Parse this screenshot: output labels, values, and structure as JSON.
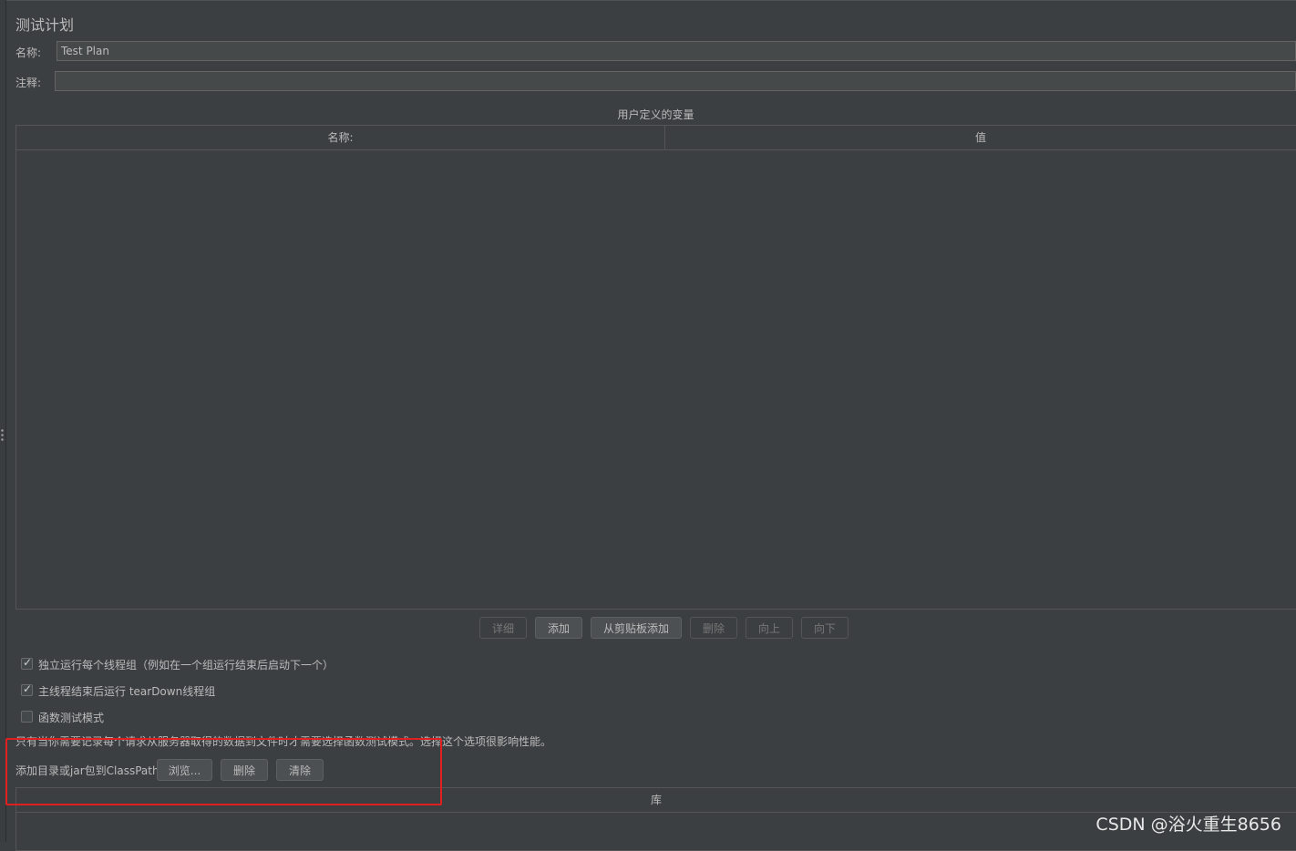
{
  "panel": {
    "title": "测试计划"
  },
  "form": {
    "name_label": "名称:",
    "name_value": "Test Plan",
    "comment_label": "注释:",
    "comment_value": ""
  },
  "variables_table": {
    "caption": "用户定义的变量",
    "columns": [
      "名称:",
      "值"
    ]
  },
  "table_buttons": {
    "detail": "详细",
    "add": "添加",
    "add_from_clipboard": "从剪贴板添加",
    "delete": "删除",
    "up": "向上",
    "down": "向下"
  },
  "options": {
    "serialize_thread_groups": {
      "label": "独立运行每个线程组（例如在一个组运行结束后启动下一个）",
      "checked": true
    },
    "teardown_after_shutdown": {
      "label": "主线程结束后运行 tearDown线程组",
      "checked": true
    },
    "functional_mode": {
      "label": "函数测试模式",
      "checked": false
    }
  },
  "functional_mode_hint": "只有当你需要记录每个请求从服务器取得的数据到文件时才需要选择函数测试模式。选择这个选项很影响性能。",
  "classpath": {
    "label": "添加目录或jar包到ClassPath",
    "browse": "浏览...",
    "delete": "删除",
    "clear": "清除"
  },
  "library_table": {
    "column": "库"
  },
  "watermark": "CSDN @浴火重生8656",
  "colors": {
    "background": "#3c3f41",
    "text": "#bbbbbb",
    "highlight_box": "#e02020"
  }
}
